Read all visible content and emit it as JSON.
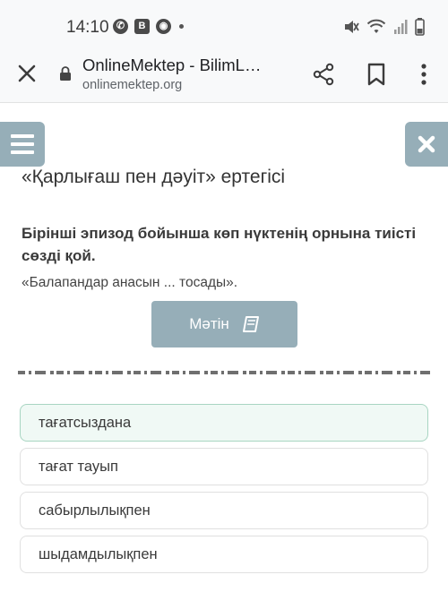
{
  "status_bar": {
    "time": "14:10",
    "icons": [
      "whatsapp-icon",
      "b-app-icon",
      "vpn-icon",
      "dot",
      "mute-icon",
      "wifi-icon",
      "signal-icon",
      "battery-icon"
    ]
  },
  "browser": {
    "title": "OnlineMektep - BilimL…",
    "url": "onlinemektep.org"
  },
  "page": {
    "title": "«Қарлығаш пен дәуіт» ертегісі",
    "question": "Бірінші эпизод бойынша көп нүктенің орнына тиісті сөзді қой.",
    "sentence": "«Балапандар анасын ... тосады».",
    "text_button": "Мәтін"
  },
  "options": [
    {
      "label": "тағатсыздана",
      "selected": true
    },
    {
      "label": "тағат тауып",
      "selected": false
    },
    {
      "label": "сабырлылықпен",
      "selected": false
    },
    {
      "label": "шыдамдылықпен",
      "selected": false
    }
  ],
  "colors": {
    "accent": "#96aeb8",
    "selected_bg": "#f0f9f5",
    "selected_border": "#a8d5c2"
  }
}
